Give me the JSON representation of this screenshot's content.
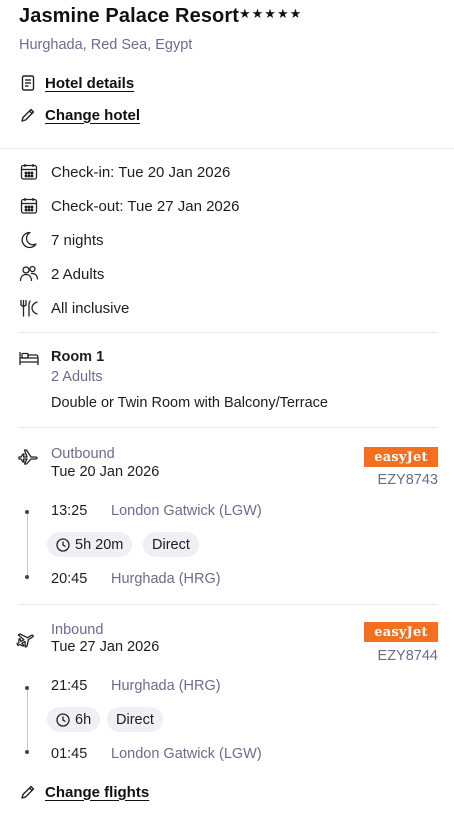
{
  "hotel": {
    "name": "Jasmine Palace Resort",
    "stars": "★★★★★",
    "location": "Hurghada, Red Sea, Egypt",
    "details_link": "Hotel details",
    "change_link": "Change hotel"
  },
  "stay": {
    "check_in": "Check-in: Tue 20 Jan 2026",
    "check_out": "Check-out: Tue 27 Jan 2026",
    "nights": "7 nights",
    "guests": "2 Adults",
    "board": "All inclusive"
  },
  "room": {
    "title": "Room 1",
    "occupancy": "2 Adults",
    "type": "Double or Twin Room with Balcony/Terrace"
  },
  "outbound": {
    "label": "Outbound",
    "date": "Tue 20 Jan 2026",
    "airline": "easyJet",
    "flight_number": "EZY8743",
    "depart_time": "13:25",
    "depart_airport": "London Gatwick (LGW)",
    "duration": "5h 20m",
    "stops": "Direct",
    "arrive_time": "20:45",
    "arrive_airport": "Hurghada (HRG)"
  },
  "inbound": {
    "label": "Inbound",
    "date": "Tue 27 Jan 2026",
    "airline": "easyJet",
    "flight_number": "EZY8744",
    "depart_time": "21:45",
    "depart_airport": "Hurghada (HRG)",
    "duration": "6h",
    "stops": "Direct",
    "arrive_time": "01:45",
    "arrive_airport": "London Gatwick (LGW)"
  },
  "actions": {
    "change_flights": "Change flights"
  },
  "colors": {
    "brand_badge": "#f37021",
    "muted_text": "#6d6c8c",
    "pill_bg": "#efeff5",
    "divider": "#e8e8ee"
  }
}
